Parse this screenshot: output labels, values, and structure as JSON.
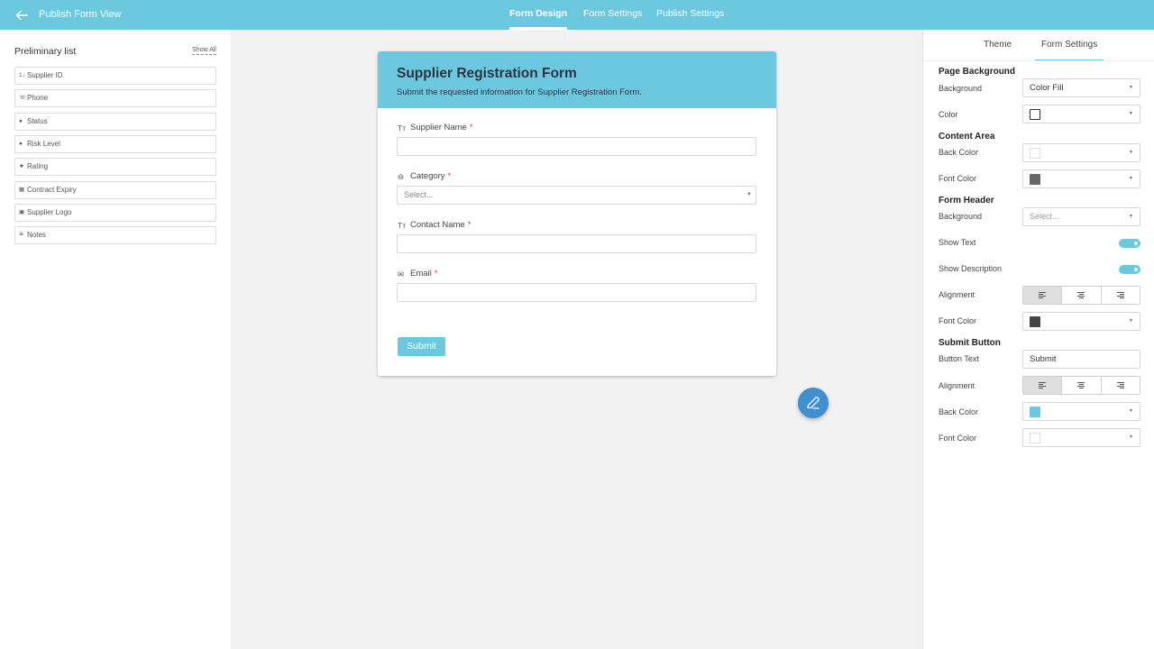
{
  "topbar": {
    "back_label": "Publish Form View",
    "tabs": [
      {
        "label": "Form Design",
        "active": true
      },
      {
        "label": "Form Settings",
        "active": false
      },
      {
        "label": "Publish Settings",
        "active": false
      }
    ],
    "color": "#6cc8de"
  },
  "left_panel": {
    "title": "Preliminary list",
    "show_all": "Show All",
    "fields": [
      {
        "label": "Supplier ID",
        "icon": "number-icon"
      },
      {
        "label": "Phone",
        "icon": "phone-icon"
      },
      {
        "label": "Status",
        "icon": "radio-icon"
      },
      {
        "label": "Risk Level",
        "icon": "radio-icon"
      },
      {
        "label": "Rating",
        "icon": "star-icon"
      },
      {
        "label": "Contract Expiry",
        "icon": "calendar-icon"
      },
      {
        "label": "Supplier Logo",
        "icon": "image-icon"
      },
      {
        "label": "Notes",
        "icon": "paragraph-icon"
      }
    ]
  },
  "form": {
    "title": "Supplier Registration Form",
    "description": "Submit the requested information for Supplier Registration Form.",
    "questions": [
      {
        "label": "Supplier Name",
        "required": "*",
        "icon": "text-icon",
        "placeholder": ""
      },
      {
        "label": "Category",
        "required": "*",
        "icon": "select-icon",
        "placeholder": "Select..."
      },
      {
        "label": "Contact Name",
        "required": "*",
        "icon": "text-icon",
        "placeholder": ""
      },
      {
        "label": "Email",
        "required": "*",
        "icon": "email-icon",
        "placeholder": ""
      }
    ],
    "submit_label": "Submit"
  },
  "right_panel": {
    "tabs": [
      {
        "label": "Theme",
        "active": false
      },
      {
        "label": "Form Settings",
        "active": true
      }
    ],
    "page_background": {
      "title": "Page Background",
      "background_label": "Background",
      "background_value": "Color Fill",
      "color_label": "Color",
      "color_value": "#ffffff"
    },
    "content_area": {
      "title": "Content Area",
      "back_color_label": "Back Color",
      "back_color_value": "#ffffff",
      "font_color_label": "Font Color",
      "font_color_value": "#666666"
    },
    "form_header": {
      "title": "Form Header",
      "background_label": "Background",
      "background_placeholder": "Select...",
      "show_text_label": "Show Text",
      "show_text": true,
      "show_description_label": "Show Description",
      "show_description": true,
      "alignment_label": "Alignment",
      "alignment": "left",
      "font_color_label": "Font Color",
      "font_color_value": "#444444"
    },
    "submit_button": {
      "title": "Submit Button",
      "button_text_label": "Button Text",
      "button_text_value": "Submit",
      "alignment_label": "Alignment",
      "alignment": "left",
      "back_color_label": "Back Color",
      "back_color_value": "#6cc8de",
      "font_color_label": "Font Color",
      "font_color_value": "#ffffff"
    }
  }
}
